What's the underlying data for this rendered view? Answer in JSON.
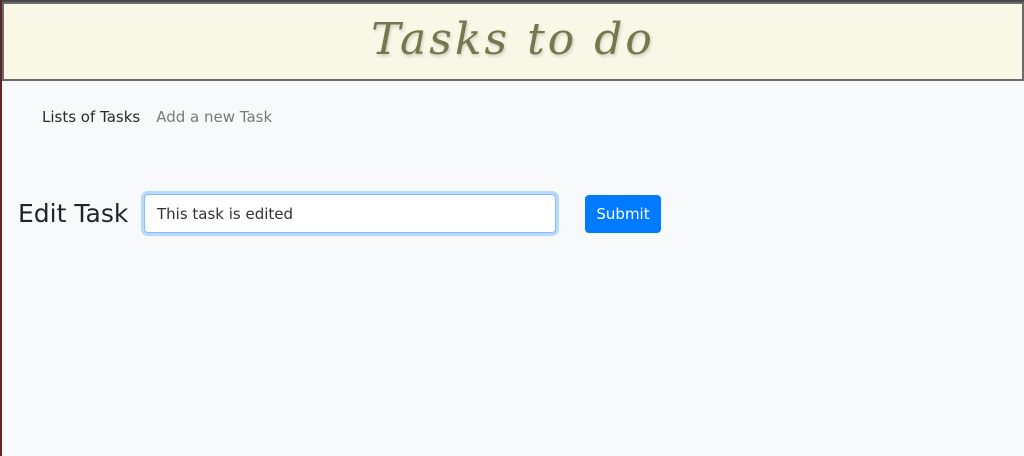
{
  "header": {
    "title": "Tasks to do"
  },
  "nav": {
    "items": [
      {
        "label": "Lists of Tasks"
      },
      {
        "label": "Add a new Task"
      }
    ]
  },
  "edit_form": {
    "heading": "Edit Task",
    "task_input_value": "This task is edited",
    "submit_label": "Submit"
  },
  "colors": {
    "header_bg": "#f9f7e6",
    "title_color": "#77774f",
    "page_bg": "#f8f9fa",
    "primary": "#007bff"
  }
}
